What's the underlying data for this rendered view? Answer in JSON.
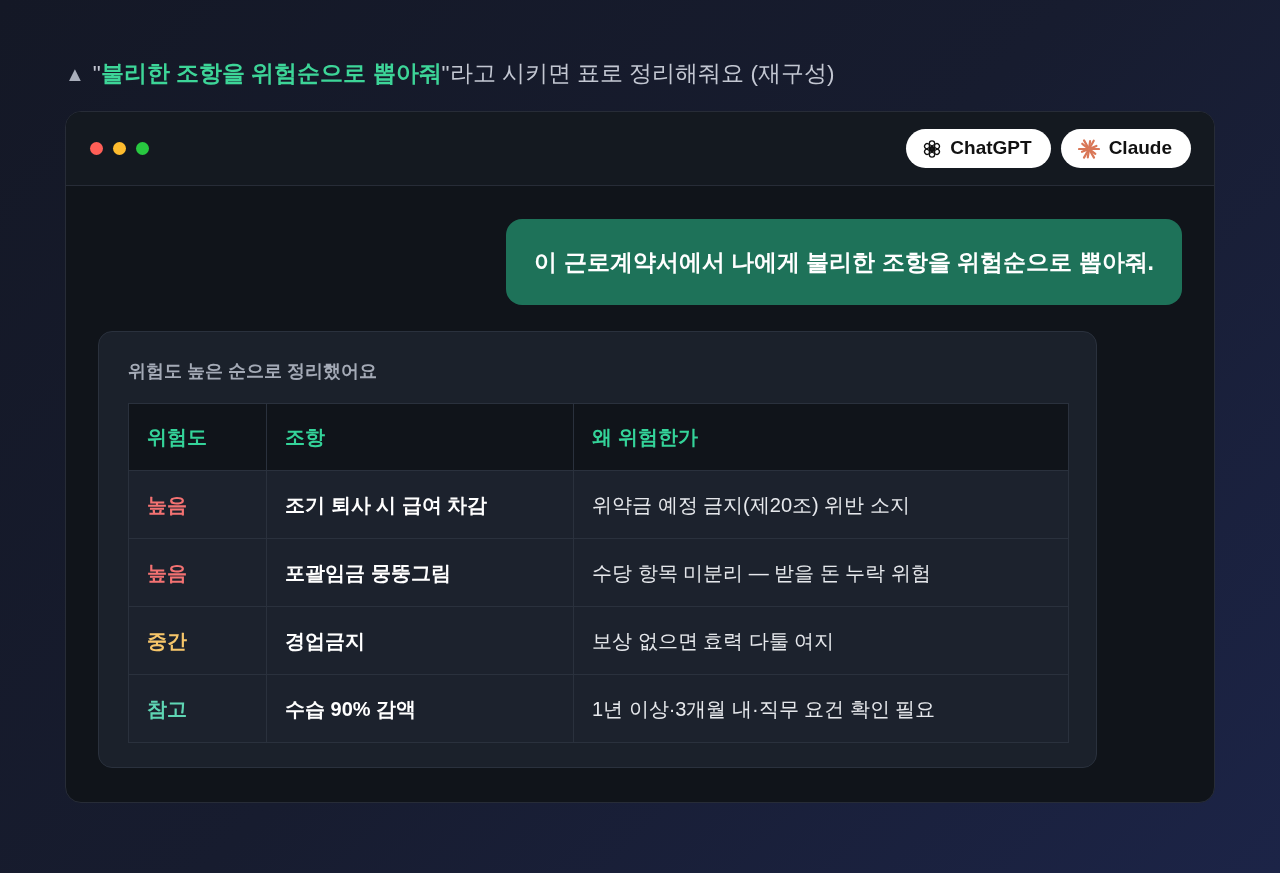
{
  "caption": {
    "marker": "▲",
    "parts": [
      {
        "text": "\"",
        "highlight": false
      },
      {
        "text": "불리한 조항을 위험순으로 뽑아줘",
        "highlight": true
      },
      {
        "text": "\"라고 시키면 표로 정리해줘요 (재구성)",
        "highlight": false
      }
    ]
  },
  "window": {
    "model_buttons": [
      {
        "label": "ChatGPT",
        "kind": "knot"
      },
      {
        "label": "Claude",
        "kind": "starburst"
      }
    ],
    "user_message": "이 근로계약서에서 나에게 불리한 조항을 위험순으로 뽑아줘.",
    "response": {
      "title": "위험도 높은 순으로 정리했어요",
      "table": {
        "columns": [
          "위험도",
          "조항",
          "왜 위험한가"
        ],
        "rows": [
          {
            "risk": "높음",
            "color": "#f47272",
            "clause": "조기 퇴사 시 급여 차감",
            "reason": "위약금 예정 금지(제20조) 위반 소지"
          },
          {
            "risk": "높음",
            "color": "#f47272",
            "clause": "포괄임금 뭉뚱그림",
            "reason": "수당 항목 미분리 — 받을 돈 누락 위험"
          },
          {
            "risk": "중간",
            "color": "#f6c66a",
            "clause": "경업금지",
            "reason": "보상 없으면 효력 다툴 여지"
          },
          {
            "risk": "참고",
            "color": "#5fd6b4",
            "clause": "수습 90% 감액",
            "reason": "1년 이상·3개월 내·직무 요건 확인 필요"
          }
        ]
      }
    }
  }
}
